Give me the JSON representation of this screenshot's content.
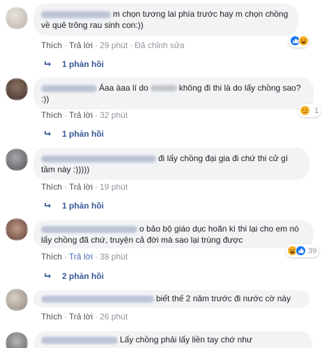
{
  "comments": [
    {
      "text_parts": [
        "m chọn tương lai phía trước hay m chọn chồng",
        "về quê trông rau sinh con:))"
      ],
      "actions": {
        "like": "Thích",
        "reply": "Trả lời",
        "time": "29 phút",
        "edited": "Đã chỉnh sửa"
      },
      "reactions": {
        "count": "",
        "icons": [
          "like-icon",
          "haha-icon"
        ]
      },
      "replies": "1 phản hồi"
    },
    {
      "text_parts": [
        "Áaa àaa lí do",
        "không đi thi là do lấy chồng sao?",
        ":))"
      ],
      "actions": {
        "like": "Thích",
        "reply": "Trả lời",
        "time": "32 phút"
      },
      "reactions": {
        "count": "1",
        "icons": [
          "sad-icon"
        ]
      },
      "replies": "1 phản hồi"
    },
    {
      "text_parts": [
        "đi lấy chồng đại gia đi chứ thi cử gì",
        "tầm này :)))))"
      ],
      "actions": {
        "like": "Thích",
        "reply": "Trả lời",
        "time": "19 phút"
      },
      "replies": "1 phản hồi"
    },
    {
      "text_parts": [
        "o bảo bộ giáo dục hoãn kì thi lại cho em nó",
        "lấy chồng đã chứ, truyện cả đời mà sao lại trùng được"
      ],
      "actions": {
        "like": "Thích",
        "reply": "Trả lời",
        "time": "38 phút"
      },
      "reactions": {
        "count": "39",
        "icons": [
          "haha-icon",
          "like-icon"
        ]
      },
      "replies": "2 phản hồi"
    },
    {
      "text_parts": [
        "biết thế 2 năm trước đi nước cờ này"
      ],
      "actions": {
        "like": "Thích",
        "reply": "Trả lời",
        "time": "26 phút"
      }
    },
    {
      "text_parts": [
        "Lấy chồng phải lấy liền tay chớ như"
      ]
    }
  ],
  "colors": {
    "link": "#385898",
    "meta": "#90949c",
    "bubble": "#f2f3f5",
    "like": "#1877f2",
    "haha": "#f7b125"
  }
}
